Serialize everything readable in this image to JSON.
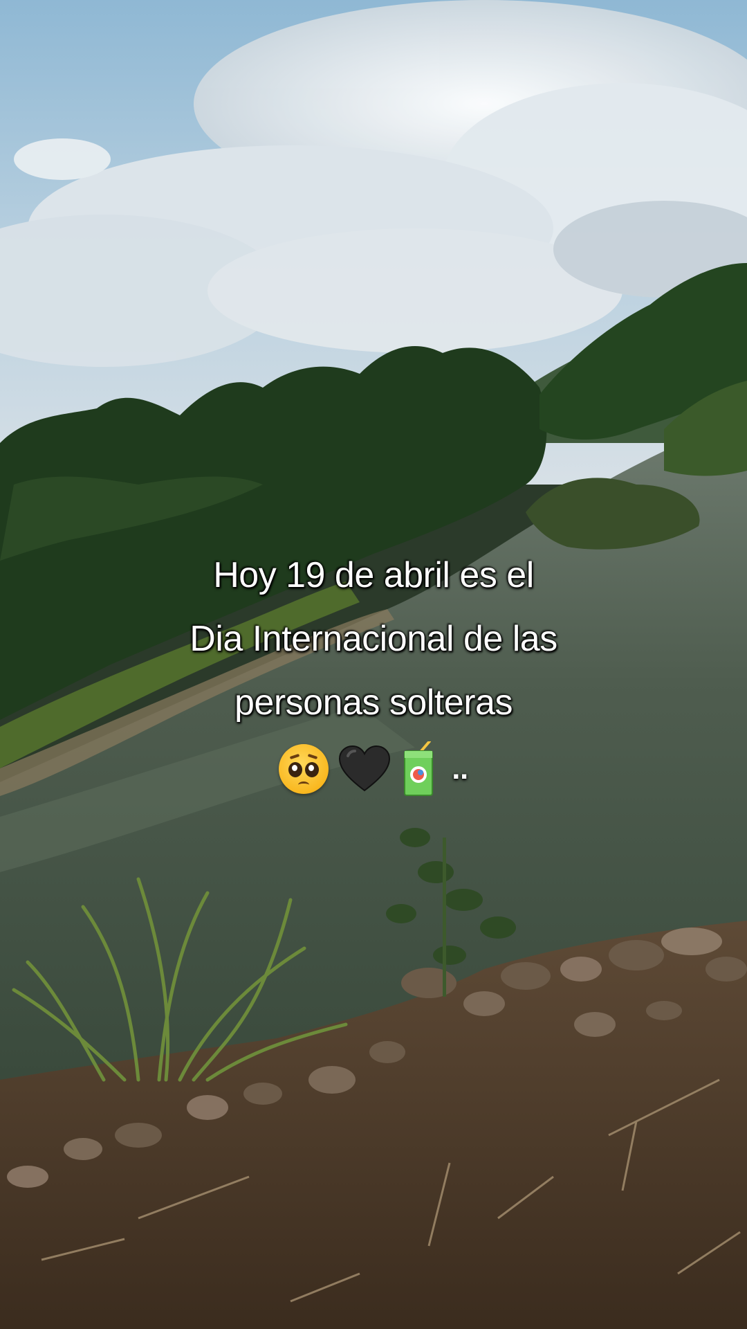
{
  "caption": {
    "line1": "Hoy 19 de abril es el",
    "line2": "Dia Internacional de las",
    "line3": "personas solteras",
    "trailing": ".."
  },
  "emojis": [
    {
      "icon": "pleading-face-icon"
    },
    {
      "icon": "black-heart-icon"
    },
    {
      "icon": "juice-box-icon"
    }
  ],
  "colors": {
    "sky": "#9fc3dc",
    "clouds": "#e9eef2",
    "trees": "#1f3a1c",
    "water": "#4a5a4a",
    "ground": "#5a4632",
    "text": "#ffffff"
  }
}
